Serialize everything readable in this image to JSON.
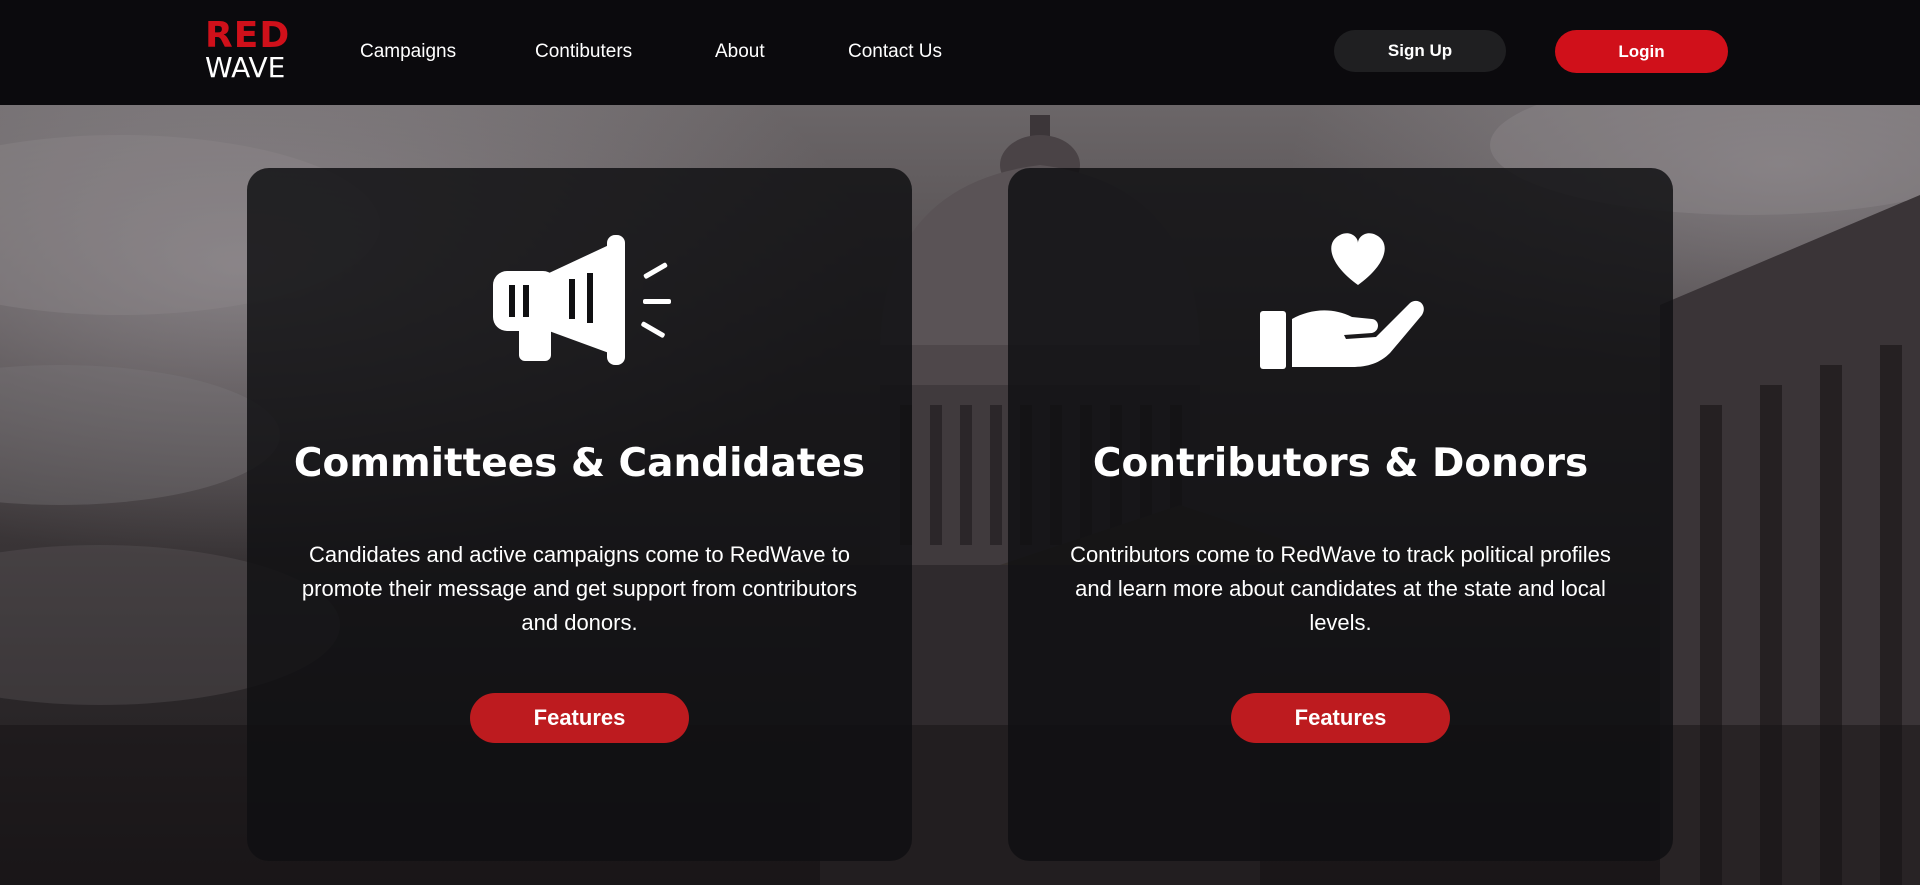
{
  "brand": {
    "logo_top": "RED",
    "logo_bottom": "WAVE",
    "accent_color": "#d0101a"
  },
  "nav": {
    "links": [
      {
        "label": "Campaigns"
      },
      {
        "label": "Contibuters"
      },
      {
        "label": "About"
      },
      {
        "label": "Contact Us"
      }
    ],
    "signup_label": "Sign Up",
    "login_label": "Login"
  },
  "cards": [
    {
      "icon": "megaphone-icon",
      "title": "Committees & Candidates",
      "text": "Candidates and active campaigns come to RedWave to promote their message and get support from contributors and donors.",
      "button_label": "Features"
    },
    {
      "icon": "heart-in-hand-icon",
      "title": "Contributors & Donors",
      "text": "Contributors come to RedWave to track political profiles and learn more about candidates at the state and local levels.",
      "button_label": "Features"
    }
  ],
  "colors": {
    "nav_background": "#0b0a0d",
    "signup_background": "#1f1f21",
    "feature_button": "#bd1b1f",
    "card_background": "rgba(16,16,18,0.84)"
  }
}
